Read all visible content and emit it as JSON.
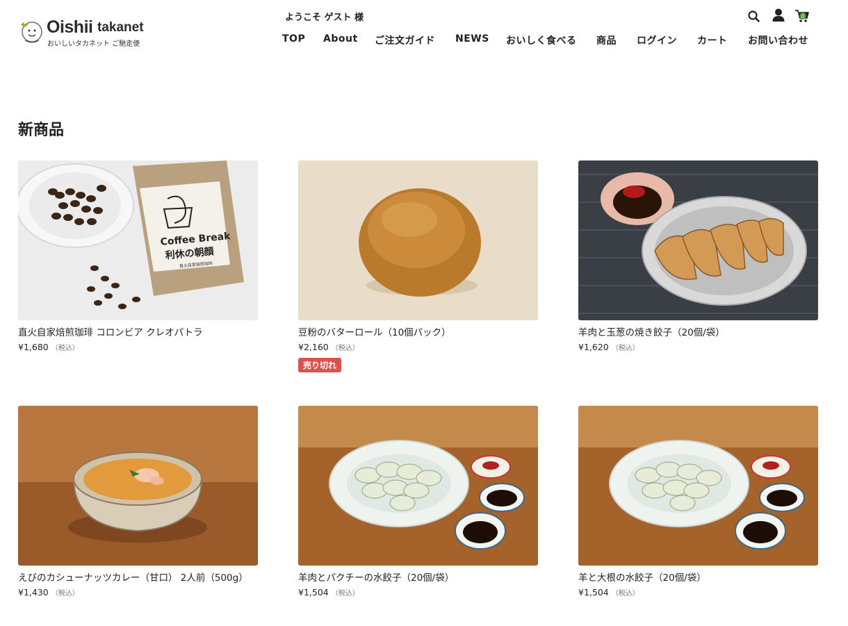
{
  "header": {
    "logo_word": "Oishii",
    "logo_word2": "takanet",
    "logo_sub": "おいしいタカネット ご馳走便",
    "welcome": "ようこそ ゲスト 様",
    "cart_count": "0",
    "icons": [
      "search-icon",
      "user-icon",
      "cart-icon"
    ]
  },
  "nav": [
    "TOP",
    "About",
    "ご注文ガイド",
    "NEWS",
    "おいしく食べる",
    "商品",
    "ログイン",
    "カート",
    "お問い合わせ"
  ],
  "section_title": "新商品",
  "products": [
    {
      "name": "直火自家焙煎珈琲 コロンビア クレオパトラ",
      "price": "¥1,680",
      "tax": "（税込）",
      "badge": "",
      "bag_text1": "Coffee Break",
      "bag_text2": "利休の朝顔",
      "bag_text3": "直火自家焙煎珈琲"
    },
    {
      "name": "豆粉のバターロール（10個パック）",
      "price": "¥2,160",
      "tax": "（税込）",
      "badge": "売り切れ"
    },
    {
      "name": "羊肉と玉葱の焼き餃子（20個/袋）",
      "price": "¥1,620",
      "tax": "（税込）",
      "badge": ""
    },
    {
      "name": "えびのカシューナッツカレー（甘口） 2人前（500g）",
      "price": "¥1,430",
      "tax": "（税込）",
      "badge": ""
    },
    {
      "name": "羊肉とパクチーの水餃子（20個/袋）",
      "price": "¥1,504",
      "tax": "（税込）",
      "badge": ""
    },
    {
      "name": "羊と大根の水餃子（20個/袋）",
      "price": "¥1,504",
      "tax": "（税込）",
      "badge": ""
    }
  ],
  "colors": {
    "soldout": "#d9534f",
    "cart_badge": "#4a8a2a"
  }
}
